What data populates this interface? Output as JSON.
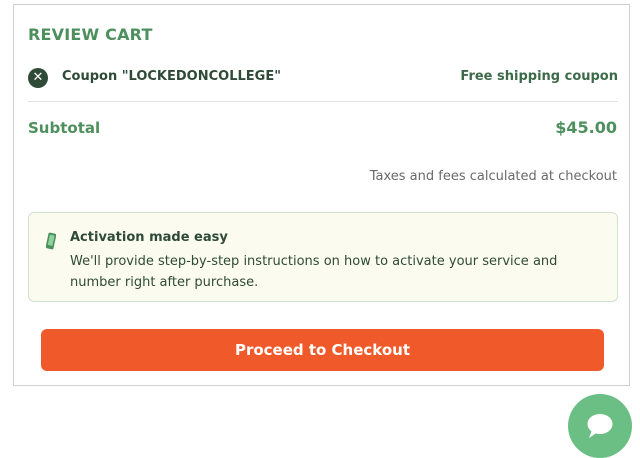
{
  "cart": {
    "title": "REVIEW CART",
    "coupon": {
      "remove_symbol": "✕",
      "label": "Coupon \"LOCKEDONCOLLEGE\"",
      "description": "Free shipping coupon"
    },
    "subtotal": {
      "label": "Subtotal",
      "value": "$45.00"
    },
    "taxes_note": "Taxes and fees calculated at checkout",
    "activation": {
      "icon": "phone-icon",
      "title": "Activation made easy",
      "text": "We'll provide step-by-step instructions on how to activate your service and number right after purchase."
    },
    "checkout_label": "Proceed to Checkout"
  },
  "chat": {
    "icon": "chat-bubble-icon"
  },
  "colors": {
    "heading_green": "#4d8f5d",
    "dark_green": "#2f4a37",
    "checkout_orange": "#f05a2b",
    "chat_green": "#6cbf84",
    "info_bg": "#fbfcef"
  }
}
